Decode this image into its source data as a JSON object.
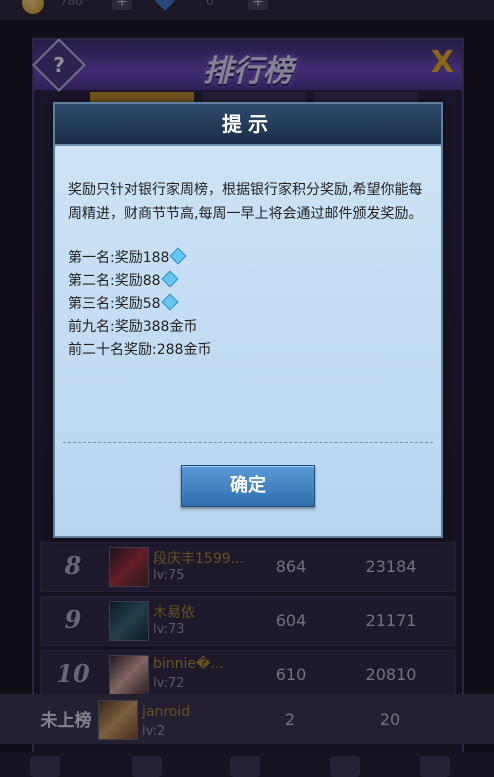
{
  "topbar": {
    "coins": "780",
    "gems": "0"
  },
  "leaderboard": {
    "title": "排行榜",
    "help_label": "?",
    "close_label": "X",
    "rows": [
      {
        "rank": "8",
        "name": "段庆丰1599...",
        "level": "lv:75",
        "score1": "864",
        "score2": "23184"
      },
      {
        "rank": "9",
        "name": "木易依",
        "level": "lv:73",
        "score1": "604",
        "score2": "21171"
      },
      {
        "rank": "10",
        "name": "binnie�...",
        "level": "lv:72",
        "score1": "610",
        "score2": "20810"
      }
    ],
    "self": {
      "rank": "未上榜",
      "name": "janroid",
      "level": "lv:2",
      "score1": "2",
      "score2": "20"
    }
  },
  "dialog": {
    "title": "提示",
    "description": "奖励只针对银行家周榜，根据银行家积分奖励,希望你能每周精进，财商节节高,每周一早上将会通过邮件颁发奖励。",
    "rewards": [
      {
        "text": "第一名:奖励188",
        "gem": true
      },
      {
        "text": "第二名:奖励88",
        "gem": true
      },
      {
        "text": "第三名:奖励58",
        "gem": true
      },
      {
        "text": "前九名:奖励388金币",
        "gem": false
      },
      {
        "text": "前二十名奖励:288金币",
        "gem": false
      }
    ],
    "confirm_label": "确定"
  },
  "colors": {
    "accent": "#6d49c4",
    "gold": "#a9912d",
    "button": "#3f80c2"
  }
}
